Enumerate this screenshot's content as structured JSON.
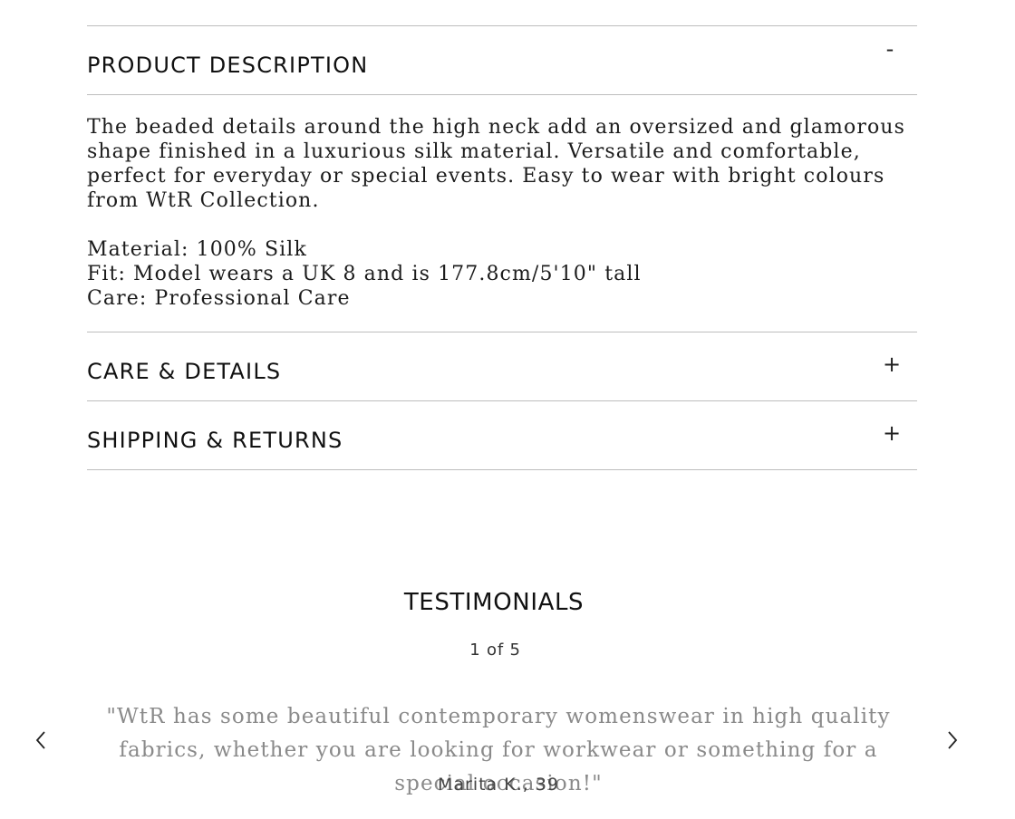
{
  "accordion": {
    "sections": [
      {
        "title": "PRODUCT DESCRIPTION",
        "toggle": "-",
        "body": {
          "description": "The beaded details around the high neck add an oversized and glamorous shape finished in a luxurious silk material. Versatile and comfortable, perfect for everyday or special events. Easy to wear with bright colours from WtR Collection.",
          "material": "Material: 100% Silk",
          "fit": "Fit: Model wears a UK 8 and is 177.8cm/5'10\" tall",
          "care": "Care: Professional Care"
        }
      },
      {
        "title": "CARE & DETAILS",
        "toggle": "+"
      },
      {
        "title": "SHIPPING & RETURNS",
        "toggle": "+"
      }
    ]
  },
  "testimonials": {
    "title": "TESTIMONIALS",
    "counter": "1 of 5",
    "quote": "\"WtR has some beautiful contemporary womenswear in high quality fabrics, whether you are looking for workwear or something for a special occasion!\"",
    "author": "Marita K., 39",
    "prev_icon": "chevron-left-icon",
    "next_icon": "chevron-right-icon"
  }
}
